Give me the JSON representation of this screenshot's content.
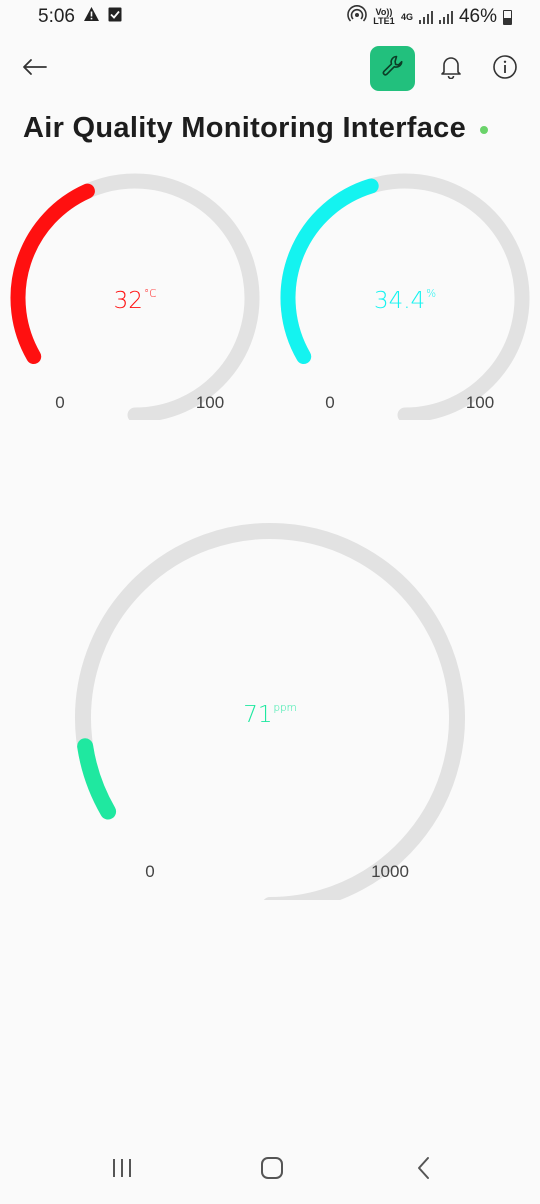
{
  "status_bar": {
    "time": "5:06",
    "volte_label": "Vo)) LTE1",
    "network_type": "4G",
    "battery_percent": "46%",
    "icons": [
      "warning-icon",
      "check-box-icon",
      "hotspot-icon",
      "signal-icon",
      "battery-icon"
    ]
  },
  "app_bar": {
    "icons": [
      "back-arrow-icon",
      "wrench-icon",
      "bell-icon",
      "info-icon"
    ],
    "accent_color": "#22c07d"
  },
  "page": {
    "title": "Air Quality Monitoring Interface",
    "status_dot_color": "#6ad36a"
  },
  "gauges": [
    {
      "id": "temperature",
      "value": "32",
      "unit": "°C",
      "min": "0",
      "max": "100",
      "numeric_value": 32,
      "numeric_min": 0,
      "numeric_max": 100,
      "color": "#ff1010"
    },
    {
      "id": "humidity",
      "value": "34.4",
      "unit": "%",
      "min": "0",
      "max": "100",
      "numeric_value": 34.4,
      "numeric_min": 0,
      "numeric_max": 100,
      "color": "#14f3f0"
    },
    {
      "id": "gas",
      "value": "71",
      "unit": "ppm",
      "min": "0",
      "max": "1000",
      "numeric_value": 71,
      "numeric_min": 0,
      "numeric_max": 1000,
      "color": "#1fe8a0"
    }
  ],
  "nav_bar": {
    "icons": [
      "recent-apps-icon",
      "home-icon",
      "back-icon"
    ]
  }
}
